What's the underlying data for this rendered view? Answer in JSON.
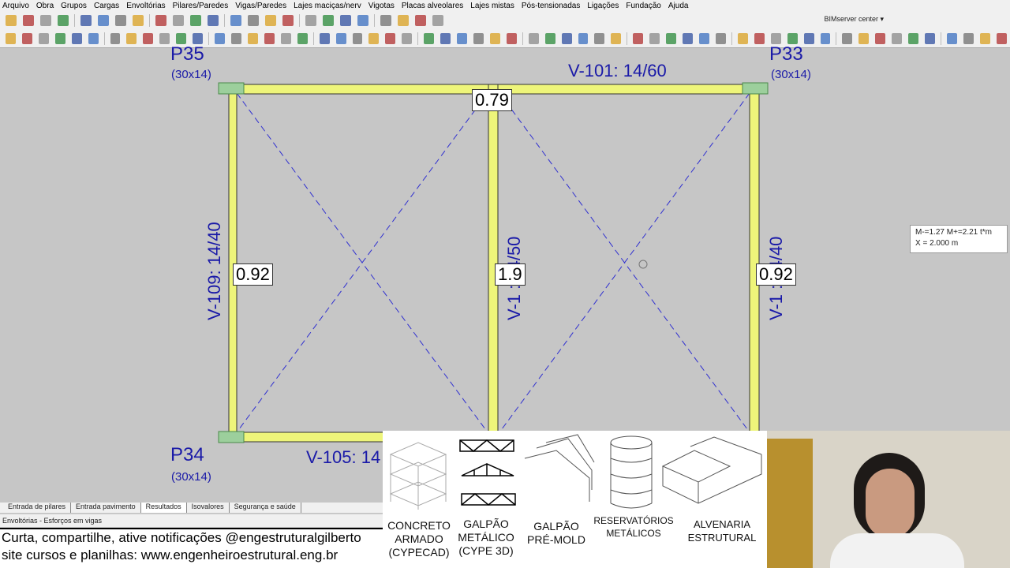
{
  "menu": [
    "Arquivo",
    "Obra",
    "Grupos",
    "Cargas",
    "Envoltórias",
    "Pilares/Paredes",
    "Vigas/Paredes",
    "Lajes maciças/nerv",
    "Vigotas",
    "Placas alveolares",
    "Lajes mistas",
    "Pós-tensionadas",
    "Ligações",
    "Fundação",
    "Ajuda"
  ],
  "bimserver": "BIMserver center ▾",
  "drawing": {
    "columns": [
      {
        "name": "P35",
        "size": "(30x14)"
      },
      {
        "name": "P33",
        "size": "(30x14)"
      },
      {
        "name": "P34",
        "size": "(30x14)"
      }
    ],
    "beams": {
      "top": "V-101: 14/60",
      "bottom": "V-105: 14",
      "left": "V-109: 14/40",
      "middle": "V-1  : 14/50",
      "right": "V-1  : 14/40"
    },
    "values": {
      "top": "0.79",
      "left": "0.92",
      "middle": "1.9",
      "right": "0.92"
    },
    "tooltip": {
      "line1": "M-=1.27 M+=2.21 t*m",
      "line2": "X = 2.000 m"
    }
  },
  "tabs": [
    "Entrada de pilares",
    "Entrada pavimento",
    "Resultados",
    "Isovalores",
    "Segurança e saúde"
  ],
  "status": "Envoltórias - Esforços em vigas",
  "promo": {
    "line1": "Curta, compartilhe, ative notificações @engestruturalgilberto",
    "line2": "site cursos e planilhas: www.engenheiroestrutural.eng.br"
  },
  "overlay": [
    "CONCRETO ARMADO (CYPECAD)",
    "GALPÃO METÁLICO (CYPE 3D)",
    "GALPÃO PRÉ-MOLD",
    "RESERVATÓRIOS METÁLICOS",
    "ALVENARIA ESTRUTURAL"
  ]
}
